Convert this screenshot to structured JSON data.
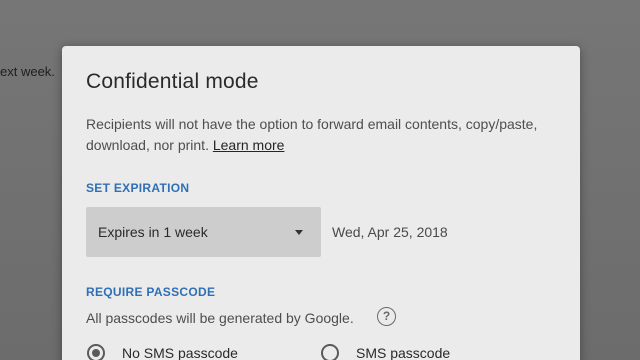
{
  "background": {
    "partial_text": "ext week."
  },
  "dialog": {
    "title": "Confidential mode",
    "description": "Recipients will not have the option to forward email contents, copy/paste, download, nor print.",
    "learn_more": "Learn more",
    "expiration": {
      "label": "SET EXPIRATION",
      "selected": "Expires in 1 week",
      "date": "Wed, Apr 25, 2018"
    },
    "passcode": {
      "label": "REQUIRE PASSCODE",
      "description": "All passcodes will be generated by Google.",
      "options": [
        {
          "label": "No SMS passcode",
          "checked": true
        },
        {
          "label": "SMS passcode",
          "checked": false
        }
      ]
    }
  },
  "colors": {
    "accent": "#2f6fb6",
    "dialog_bg": "#ebebeb",
    "select_bg": "#cdcdcd"
  },
  "icons": [
    "dropdown-caret-icon",
    "help-circle-icon",
    "radio-checked-icon",
    "radio-unchecked-icon"
  ]
}
